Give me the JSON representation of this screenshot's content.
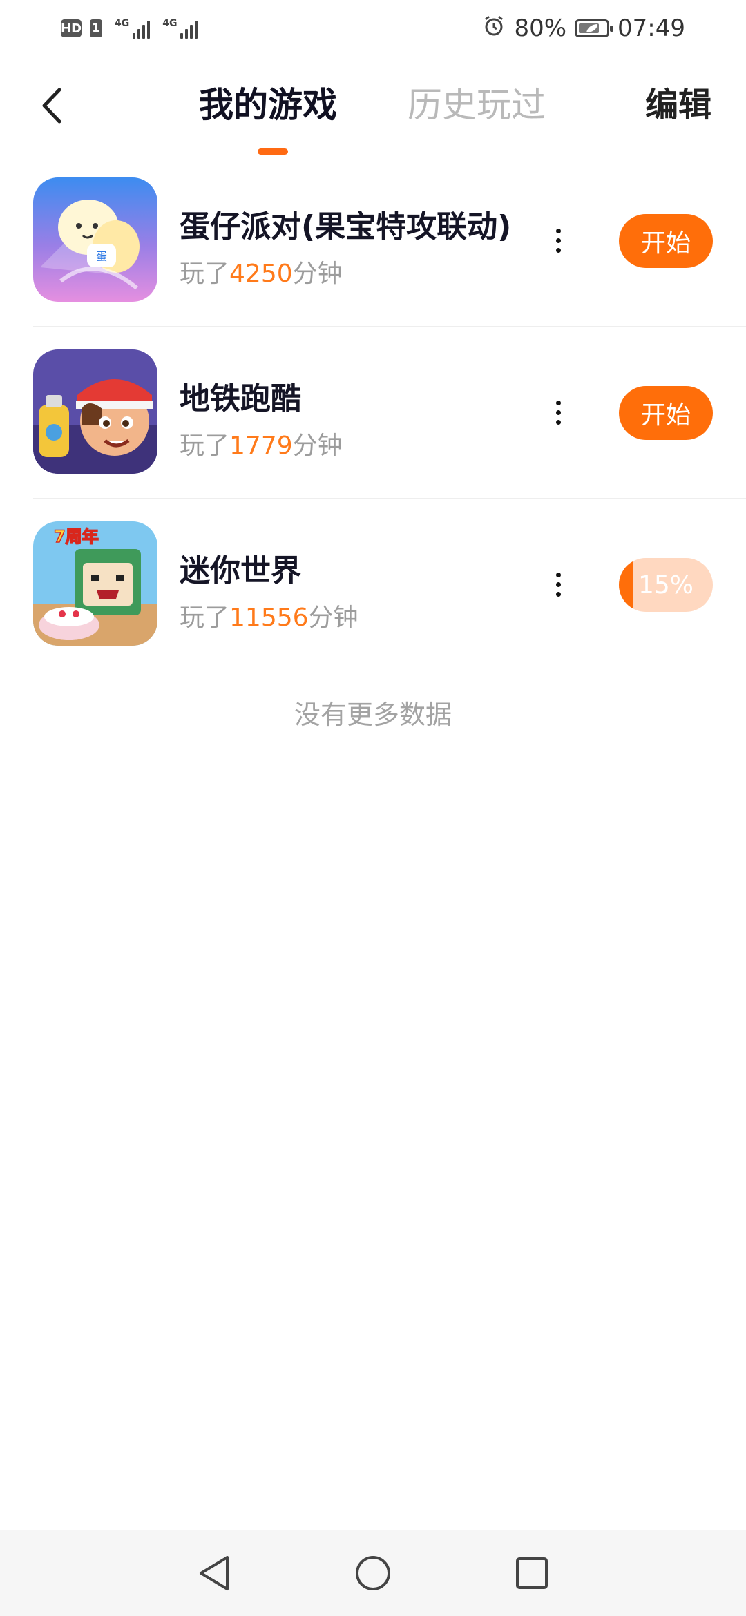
{
  "status_bar": {
    "hd_label": "HD",
    "sim_label": "1",
    "network_1": "4G",
    "network_2": "4G",
    "battery_percent": "80%",
    "battery_level": 0.8,
    "time": "07:49",
    "icons": [
      "alarm-icon",
      "battery-saver-icon"
    ]
  },
  "header": {
    "tabs": [
      {
        "label": "我的游戏",
        "active": true
      },
      {
        "label": "历史玩过",
        "active": false
      }
    ],
    "edit_label": "编辑",
    "accent_color": "#ff6a13"
  },
  "games": [
    {
      "title": "蛋仔派对(果宝特攻联动)",
      "played_prefix": "玩了",
      "minutes": "4250",
      "played_suffix": "分钟",
      "action": "开始",
      "icon": "eggy-party-game-icon"
    },
    {
      "title": "地铁跑酷",
      "played_prefix": "玩了",
      "minutes": "1779",
      "played_suffix": "分钟",
      "action": "开始",
      "icon": "subway-surfers-game-icon"
    },
    {
      "title": "迷你世界",
      "played_prefix": "玩了",
      "minutes": "11556",
      "played_suffix": "分钟",
      "action_progress": "15%",
      "progress_value": 0.15,
      "icon": "mini-world-game-icon",
      "icon_badge": "7周年"
    }
  ],
  "list_footer": "没有更多数据",
  "nav_bar": {
    "icons": [
      "back-triangle-icon",
      "home-circle-icon",
      "recents-square-icon"
    ]
  }
}
